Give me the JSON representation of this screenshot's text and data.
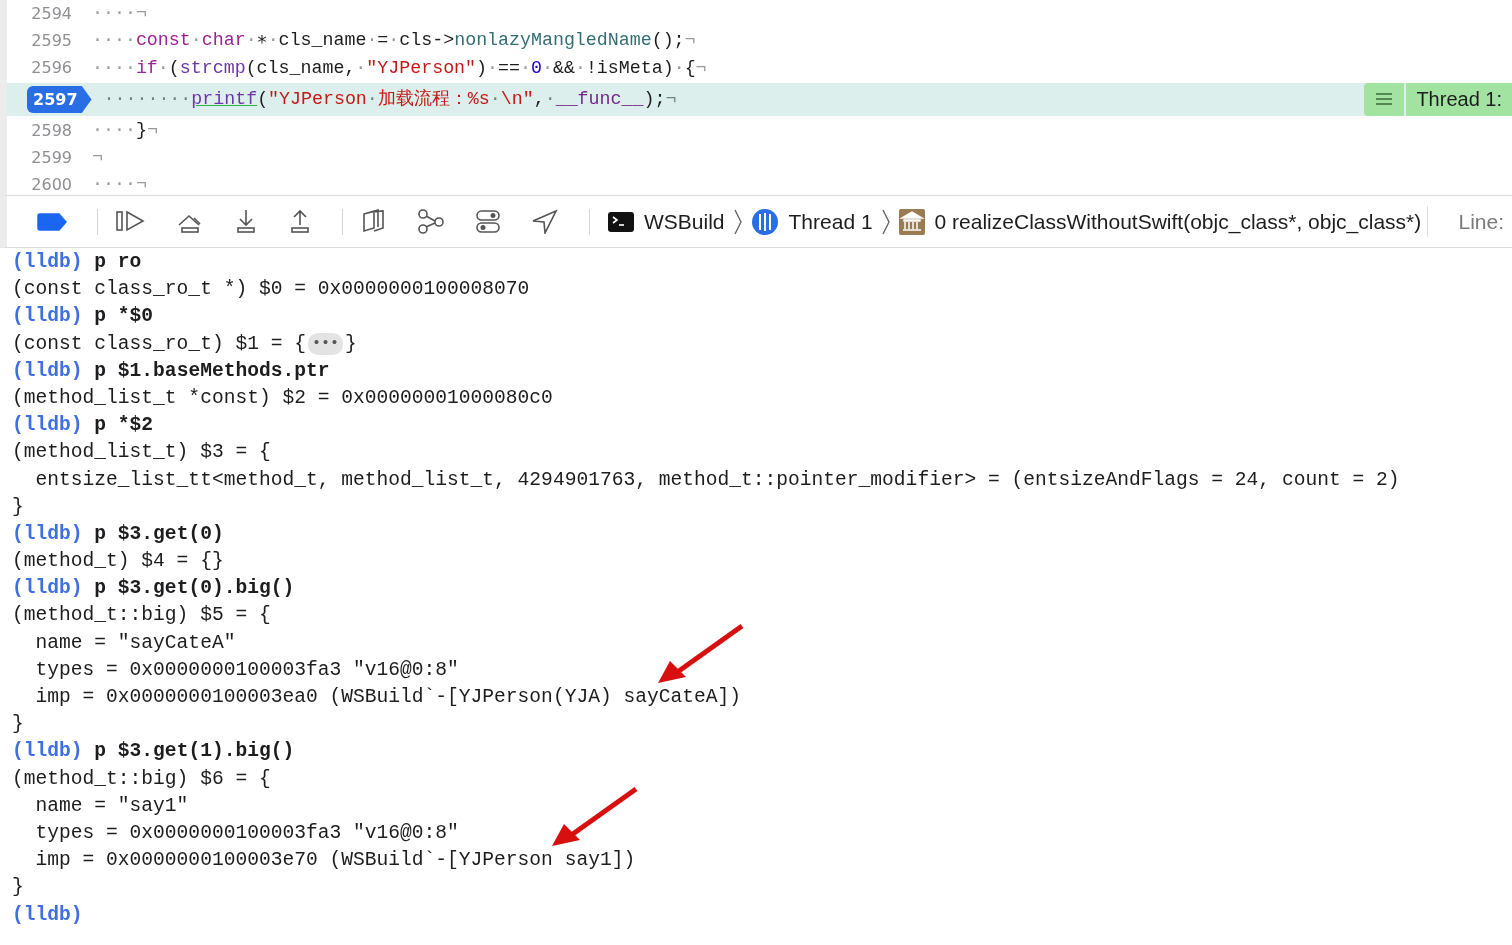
{
  "editor": {
    "lines": [
      {
        "number": "2594",
        "current": false,
        "tokens": [
          {
            "kind": "invisible",
            "text": "····¬"
          }
        ]
      },
      {
        "number": "2595",
        "current": false,
        "tokens": [
          {
            "kind": "invisible",
            "text": "····"
          },
          {
            "kind": "keyword",
            "text": "const"
          },
          {
            "kind": "invisible",
            "text": "·"
          },
          {
            "kind": "keyword",
            "text": "char"
          },
          {
            "kind": "invisible",
            "text": "·"
          },
          {
            "kind": "plain",
            "text": "∗"
          },
          {
            "kind": "invisible",
            "text": "·"
          },
          {
            "kind": "plain",
            "text": "cls_name"
          },
          {
            "kind": "invisible",
            "text": "·"
          },
          {
            "kind": "plain",
            "text": "="
          },
          {
            "kind": "invisible",
            "text": "·"
          },
          {
            "kind": "plain",
            "text": "cls->"
          },
          {
            "kind": "method",
            "text": "nonlazyMangledName"
          },
          {
            "kind": "plain",
            "text": "();"
          },
          {
            "kind": "invisible",
            "text": "¬"
          }
        ]
      },
      {
        "number": "2596",
        "current": false,
        "tokens": [
          {
            "kind": "invisible",
            "text": "····"
          },
          {
            "kind": "keyword",
            "text": "if"
          },
          {
            "kind": "invisible",
            "text": "·"
          },
          {
            "kind": "plain",
            "text": "("
          },
          {
            "kind": "function",
            "text": "strcmp"
          },
          {
            "kind": "plain",
            "text": "(cls_name,"
          },
          {
            "kind": "invisible",
            "text": "·"
          },
          {
            "kind": "string",
            "text": "\"YJPerson\""
          },
          {
            "kind": "plain",
            "text": ")"
          },
          {
            "kind": "invisible",
            "text": "·"
          },
          {
            "kind": "plain",
            "text": "=="
          },
          {
            "kind": "invisible",
            "text": "·"
          },
          {
            "kind": "number",
            "text": "0"
          },
          {
            "kind": "invisible",
            "text": "·"
          },
          {
            "kind": "plain",
            "text": "&&"
          },
          {
            "kind": "invisible",
            "text": "·"
          },
          {
            "kind": "plain",
            "text": "!isMeta)"
          },
          {
            "kind": "invisible",
            "text": "·"
          },
          {
            "kind": "plain",
            "text": "{"
          },
          {
            "kind": "invisible",
            "text": "¬"
          }
        ]
      },
      {
        "number": "2597",
        "current": true,
        "thread_label": "Thread 1:",
        "tokens": [
          {
            "kind": "invisible",
            "text": "········"
          },
          {
            "kind": "flagged",
            "text": "printf"
          },
          {
            "kind": "plain",
            "text": "("
          },
          {
            "kind": "string",
            "text": "\"YJPerson"
          },
          {
            "kind": "invisible",
            "text": "·"
          },
          {
            "kind": "string",
            "text": "加载流程：%s"
          },
          {
            "kind": "invisible",
            "text": "·"
          },
          {
            "kind": "string",
            "text": "\\n\""
          },
          {
            "kind": "plain",
            "text": ","
          },
          {
            "kind": "invisible",
            "text": "·"
          },
          {
            "kind": "macro",
            "text": "__func__"
          },
          {
            "kind": "plain",
            "text": ");"
          },
          {
            "kind": "invisible",
            "text": "¬"
          }
        ]
      },
      {
        "number": "2598",
        "current": false,
        "tokens": [
          {
            "kind": "invisible",
            "text": "····"
          },
          {
            "kind": "plain",
            "text": "}"
          },
          {
            "kind": "invisible",
            "text": "¬"
          }
        ]
      },
      {
        "number": "2599",
        "current": false,
        "tokens": [
          {
            "kind": "invisible",
            "text": "¬"
          }
        ]
      },
      {
        "number": "2600",
        "current": false,
        "tokens": [
          {
            "kind": "invisible",
            "text": "····¬"
          }
        ]
      }
    ]
  },
  "debug_bar": {
    "breakpoints_active": true,
    "breadcrumbs": [
      {
        "kind": "process",
        "label": "WSBuild"
      },
      {
        "kind": "thread",
        "label": "Thread 1"
      },
      {
        "kind": "frame",
        "label": "0 realizeClassWithoutSwift(objc_class*, objc_class*)"
      }
    ],
    "line_label": "Line:"
  },
  "console": {
    "lines": [
      {
        "kind": "command",
        "prompt": "(lldb)",
        "text": "p ro"
      },
      {
        "kind": "output",
        "text": "(const class_ro_t *) $0 = 0x0000000100008070"
      },
      {
        "kind": "command",
        "prompt": "(lldb)",
        "text": "p *$0"
      },
      {
        "kind": "collapsed",
        "text": "(const class_ro_t) $1 = {",
        "summary": "•••",
        "after": "}"
      },
      {
        "kind": "command",
        "prompt": "(lldb)",
        "text": "p $1.baseMethods.ptr"
      },
      {
        "kind": "output",
        "text": "(method_list_t *const) $2 = 0x00000001000080c0"
      },
      {
        "kind": "command",
        "prompt": "(lldb)",
        "text": "p *$2"
      },
      {
        "kind": "output",
        "text": "(method_list_t) $3 = {"
      },
      {
        "kind": "output",
        "text": "  entsize_list_tt<method_t, method_list_t, 4294901763, method_t::pointer_modifier> = (entsizeAndFlags = 24, count = 2)"
      },
      {
        "kind": "output",
        "text": "}"
      },
      {
        "kind": "command",
        "prompt": "(lldb)",
        "text": "p $3.get(0)"
      },
      {
        "kind": "output",
        "text": "(method_t) $4 = {}"
      },
      {
        "kind": "command",
        "prompt": "(lldb)",
        "text": "p $3.get(0).big()"
      },
      {
        "kind": "output",
        "text": "(method_t::big) $5 = {"
      },
      {
        "kind": "output",
        "text": "  name = \"sayCateA\""
      },
      {
        "kind": "output",
        "text": "  types = 0x0000000100003fa3 \"v16@0:8\""
      },
      {
        "kind": "output",
        "text": "  imp = 0x0000000100003ea0 (WSBuild`-[YJPerson(YJA) sayCateA])",
        "marked": true
      },
      {
        "kind": "output",
        "text": "}"
      },
      {
        "kind": "command",
        "prompt": "(lldb)",
        "text": "p $3.get(1).big()"
      },
      {
        "kind": "output",
        "text": "(method_t::big) $6 = {"
      },
      {
        "kind": "output",
        "text": "  name = \"say1\""
      },
      {
        "kind": "output",
        "text": "  types = 0x0000000100003fa3 \"v16@0:8\""
      },
      {
        "kind": "output",
        "text": "  imp = 0x0000000100003e70 (WSBuild`-[YJPerson say1])",
        "marked": true
      },
      {
        "kind": "output",
        "text": "}"
      },
      {
        "kind": "command",
        "prompt": "(lldb)"
      }
    ]
  }
}
